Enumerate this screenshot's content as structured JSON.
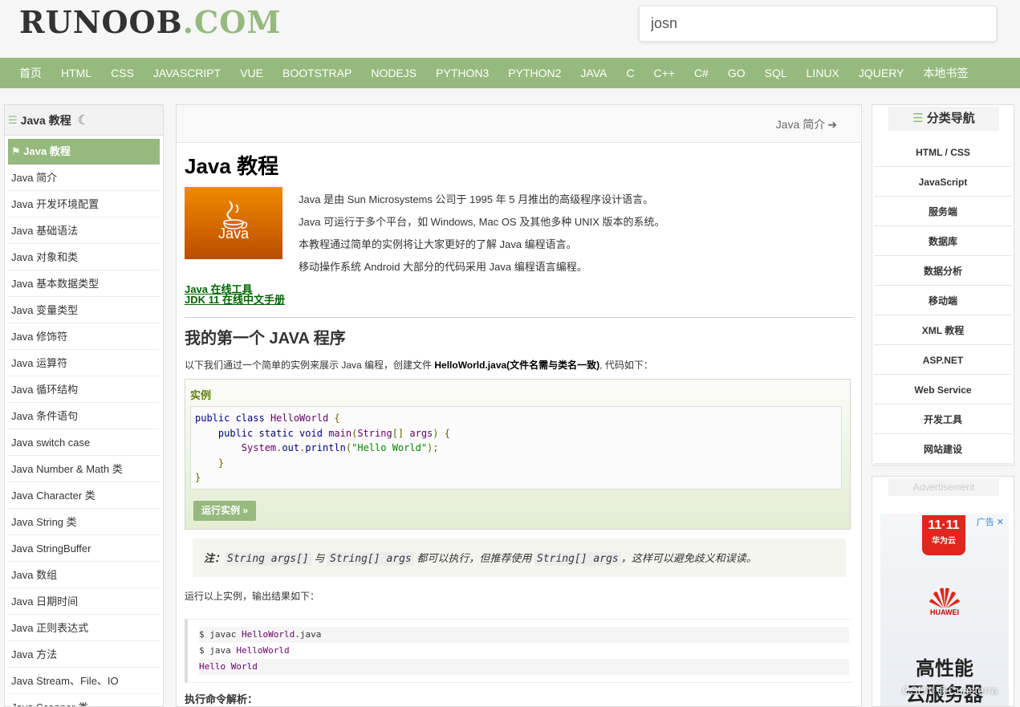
{
  "header": {
    "logo_main": "RUNOOB",
    "logo_dot": ".COM",
    "search_value": "josn"
  },
  "nav": [
    "首页",
    "HTML",
    "CSS",
    "JAVASCRIPT",
    "VUE",
    "BOOTSTRAP",
    "NODEJS",
    "PYTHON3",
    "PYTHON2",
    "JAVA",
    "C",
    "C++",
    "C#",
    "GO",
    "SQL",
    "LINUX",
    "JQUERY",
    "本地书签"
  ],
  "left": {
    "title": "Java 教程",
    "items": [
      "Java 教程",
      "Java 简介",
      "Java 开发环境配置",
      "Java 基础语法",
      "Java 对象和类",
      "Java 基本数据类型",
      "Java 变量类型",
      "Java 修饰符",
      "Java 运算符",
      "Java 循环结构",
      "Java 条件语句",
      "Java switch case",
      "Java Number & Math 类",
      "Java Character 类",
      "Java String 类",
      "Java StringBuffer",
      "Java 数组",
      "Java 日期时间",
      "Java 正则表达式",
      "Java 方法",
      "Java Stream、File、IO",
      "Java Scanner 类"
    ]
  },
  "main": {
    "next_label": "Java 简介",
    "title": "Java 教程",
    "logo_word": "Java",
    "intro": [
      "Java 是由 Sun Microsystems 公司于 1995 年 5 月推出的高级程序设计语言。",
      "Java 可运行于多个平台，如 Windows, Mac OS 及其他多种 UNIX 版本的系统。",
      "本教程通过简单的实例将让大家更好的了解 Java 编程语言。",
      "移动操作系统 Android 大部分的代码采用 Java 编程语言编程。"
    ],
    "link1": "Java 在线工具",
    "link2": "JDK 11 在线中文手册",
    "h2": "我的第一个 JAVA 程序",
    "desc_pre": "以下我们通过一个简单的实例来展示 Java 编程，创建文件 ",
    "desc_bold": "HelloWorld.java(文件名需与类名一致)",
    "desc_post": ", 代码如下：",
    "example_title": "实例",
    "run_button": "运行实例 »",
    "note_label": "注：",
    "note_code1": "String args[]",
    "note_mid1": " 与 ",
    "note_code2": "String[] args",
    "note_mid2": " 都可以执行，但推荐使用 ",
    "note_code3": "String[] args",
    "note_end": "，这样可以避免歧义和误读。",
    "run_output_label": "运行以上实例，输出结果如下：",
    "output_lines": [
      "$ javac HelloWorld.java",
      "$ java HelloWorld",
      "Hello World"
    ],
    "bottom_text": "执行命令解析："
  },
  "right": {
    "title": "分类导航",
    "items": [
      "HTML / CSS",
      "JavaScript",
      "服务端",
      "数据库",
      "数据分析",
      "移动端",
      "XML 教程",
      "ASP.NET",
      "Web Service",
      "开发工具",
      "网站建设"
    ],
    "ad_label": "Advertisement",
    "ad_tag": "广告 ✕",
    "ad_1111": "11·11",
    "ad_1111_sub": "华为云",
    "ad_brand": "HUAWEI",
    "ad_line1": "高性能",
    "ad_line2": "云服务器"
  },
  "watermark": "CSDN @Cuasterra"
}
